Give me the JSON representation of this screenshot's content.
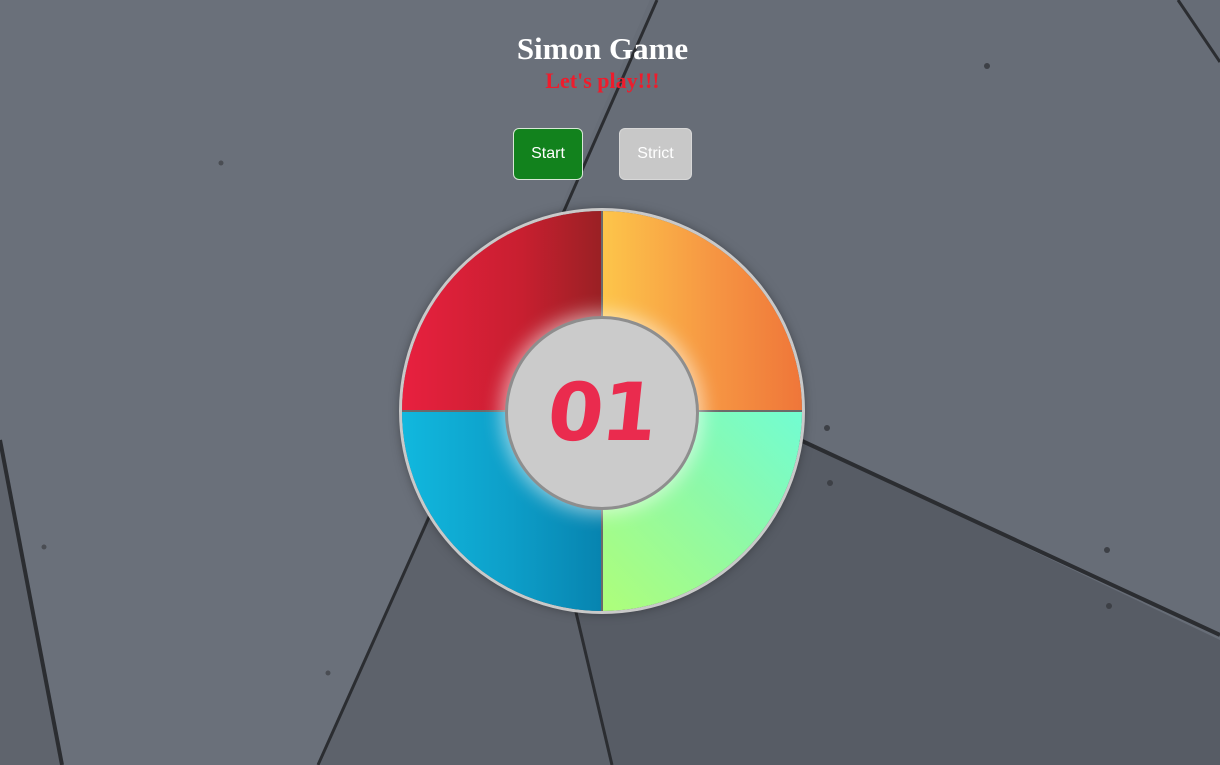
{
  "header": {
    "title": "Simon Game",
    "subtitle": "Let's play!!!"
  },
  "controls": {
    "start_label": "Start",
    "strict_label": "Strict"
  },
  "board": {
    "count": "01",
    "pads": [
      "red",
      "orange",
      "blue",
      "green"
    ]
  },
  "colors": {
    "background": "#666c76",
    "title": "#ffffff",
    "subtitle": "#ee1c2c",
    "start_button": "#12821d",
    "strict_button": "#c8c8c8",
    "red_pad": "#e8203f",
    "orange_pad": "#f69643",
    "blue_pad": "#11b8de",
    "green_pad": "#8ef9a8",
    "counter": "#ea2b4e",
    "center": "#cbcbcb"
  }
}
